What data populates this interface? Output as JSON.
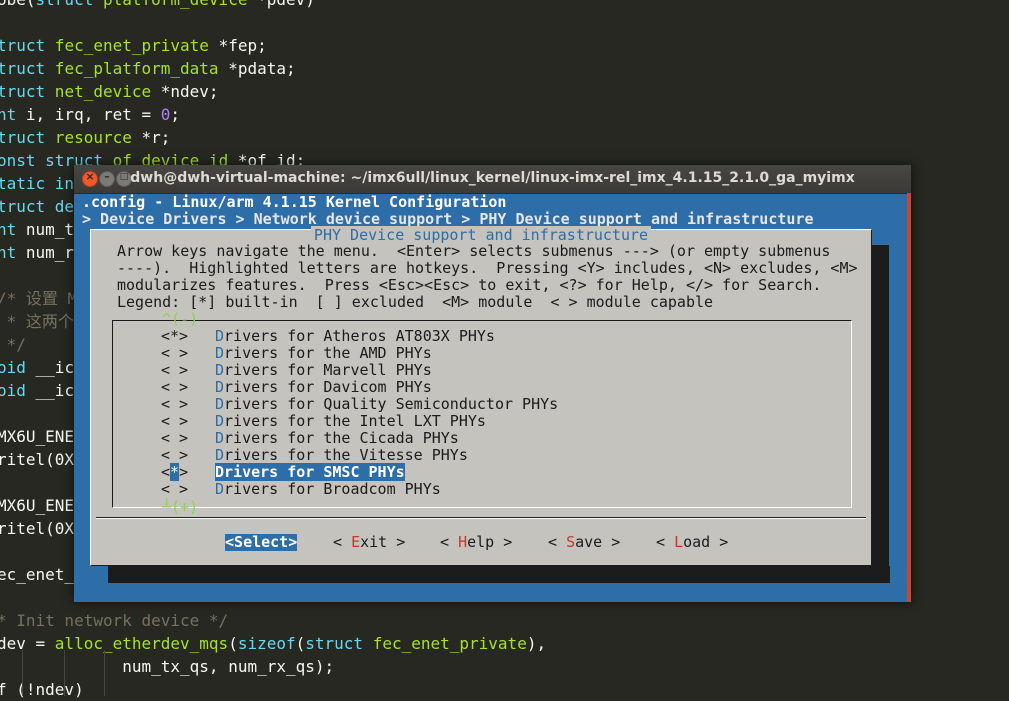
{
  "editor": {
    "lines": [
      {
        "parts": [
          {
            "t": "obe(",
            "c": ""
          },
          {
            "t": "struct",
            "c": "kw"
          },
          {
            "t": " platform_device ",
            "c": "ty"
          },
          {
            "t": "*pdev)",
            "c": ""
          }
        ]
      },
      {
        "parts": []
      },
      {
        "parts": [
          {
            "t": "truct",
            "c": "kw"
          },
          {
            "t": " fec_enet_private ",
            "c": "ty"
          },
          {
            "t": "*fep;",
            "c": ""
          }
        ]
      },
      {
        "parts": [
          {
            "t": "truct",
            "c": "kw"
          },
          {
            "t": " fec_platform_data ",
            "c": "ty"
          },
          {
            "t": "*pdata;",
            "c": ""
          }
        ]
      },
      {
        "parts": [
          {
            "t": "truct",
            "c": "kw"
          },
          {
            "t": " net_device ",
            "c": "ty"
          },
          {
            "t": "*ndev;",
            "c": ""
          }
        ]
      },
      {
        "parts": [
          {
            "t": "nt",
            "c": "kw"
          },
          {
            "t": " i, irq, ret = ",
            "c": ""
          },
          {
            "t": "0",
            "c": "nm"
          },
          {
            "t": ";",
            "c": ""
          }
        ]
      },
      {
        "parts": [
          {
            "t": "truct",
            "c": "kw"
          },
          {
            "t": " resource ",
            "c": "ty"
          },
          {
            "t": "*r;",
            "c": ""
          }
        ]
      },
      {
        "parts": [
          {
            "t": "onst struct",
            "c": "kw"
          },
          {
            "t": " of_device_id ",
            "c": "ty"
          },
          {
            "t": "*of_id;",
            "c": ""
          }
        ]
      },
      {
        "parts": [
          {
            "t": "tatic in",
            "c": "kw"
          }
        ]
      },
      {
        "parts": [
          {
            "t": "truct de",
            "c": "kw"
          }
        ]
      },
      {
        "parts": [
          {
            "t": "nt",
            "c": "kw"
          },
          {
            "t": " num_t",
            "c": ""
          }
        ]
      },
      {
        "parts": [
          {
            "t": "nt",
            "c": "kw"
          },
          {
            "t": " num_r",
            "c": ""
          }
        ]
      },
      {
        "parts": []
      },
      {
        "parts": [
          {
            "t": "/* 设置 M",
            "c": "cm"
          }
        ]
      },
      {
        "parts": [
          {
            "t": " * 这两个",
            "c": "cm"
          }
        ]
      },
      {
        "parts": [
          {
            "t": " */",
            "c": "cm"
          }
        ]
      },
      {
        "parts": [
          {
            "t": "oid",
            "c": "kw"
          },
          {
            "t": " __ic",
            "c": ""
          }
        ]
      },
      {
        "parts": [
          {
            "t": "oid",
            "c": "kw"
          },
          {
            "t": " __ic",
            "c": ""
          }
        ]
      },
      {
        "parts": []
      },
      {
        "parts": [
          {
            "t": "MX6U_ENE",
            "c": ""
          }
        ]
      },
      {
        "parts": [
          {
            "t": "ritel(0X",
            "c": ""
          }
        ]
      },
      {
        "parts": []
      },
      {
        "parts": [
          {
            "t": "MX6U_ENE",
            "c": ""
          }
        ]
      },
      {
        "parts": [
          {
            "t": "ritel(0X",
            "c": ""
          }
        ]
      },
      {
        "parts": []
      },
      {
        "parts": [
          {
            "t": "ec_enet_",
            "c": ""
          }
        ]
      },
      {
        "parts": []
      },
      {
        "parts": [
          {
            "t": "* Init network device */",
            "c": "cm"
          }
        ]
      },
      {
        "parts": [
          {
            "t": "dev = ",
            "c": ""
          },
          {
            "t": "alloc_etherdev_mqs",
            "c": "fn"
          },
          {
            "t": "(",
            "c": ""
          },
          {
            "t": "sizeof",
            "c": "kw"
          },
          {
            "t": "(",
            "c": ""
          },
          {
            "t": "struct",
            "c": "kw"
          },
          {
            "t": " fec_enet_private",
            "c": "ty"
          },
          {
            "t": "),",
            "c": ""
          }
        ]
      },
      {
        "parts": [
          {
            "t": "             num_tx_qs, num_rx_qs);",
            "c": ""
          }
        ]
      },
      {
        "parts": [
          {
            "t": "f (!ndev)",
            "c": ""
          }
        ]
      }
    ]
  },
  "window": {
    "title": "dwh@dwh-virtual-machine: ~/imx6ull/linux_kernel/linux-imx-rel_imx_4.1.15_2.1.0_ga_myimx",
    "close_glyph": "×",
    "min_glyph": "–",
    "max_glyph": "□"
  },
  "menuconfig": {
    "header": ".config - Linux/arm 4.1.15 Kernel Configuration",
    "breadcrumb": "> Device Drivers > Network device support > PHY Device support and infrastructure",
    "dialog_title": "PHY Device support and infrastructure",
    "help_lines": [
      "Arrow keys navigate the menu.  <Enter> selects submenus ---> (or empty submenus",
      "----).  Highlighted letters are hotkeys.  Pressing <Y> includes, <N> excludes, <M>",
      "modularizes features.  Press <Esc><Esc> to exit, <?> for Help, </> for Search.",
      "Legend: [*] built-in  [ ] excluded  <M> module  < > module capable"
    ],
    "scroll_up": "^(-)",
    "scroll_down": "┴(+)",
    "items": [
      {
        "mark": "<*>",
        "hot": "D",
        "rest": "rivers for Atheros AT803X PHYs",
        "selected": false
      },
      {
        "mark": "< >",
        "hot": "D",
        "rest": "rivers for the AMD PHYs",
        "selected": false
      },
      {
        "mark": "< >",
        "hot": "D",
        "rest": "rivers for Marvell PHYs",
        "selected": false
      },
      {
        "mark": "< >",
        "hot": "D",
        "rest": "rivers for Davicom PHYs",
        "selected": false
      },
      {
        "mark": "< >",
        "hot": "D",
        "rest": "rivers for Quality Semiconductor PHYs",
        "selected": false
      },
      {
        "mark": "< >",
        "hot": "D",
        "rest": "rivers for the Intel LXT PHYs",
        "selected": false
      },
      {
        "mark": "< >",
        "hot": "D",
        "rest": "rivers for the Cicada PHYs",
        "selected": false
      },
      {
        "mark": "< >",
        "hot": "D",
        "rest": "rivers for the Vitesse PHYs",
        "selected": false
      },
      {
        "mark": "<*>",
        "hot": "D",
        "rest": "rivers for SMSC PHYs",
        "selected": true
      },
      {
        "mark": "< >",
        "hot": "D",
        "rest": "rivers for Broadcom PHYs",
        "selected": false
      }
    ],
    "buttons": [
      {
        "pre": "<",
        "hot": "S",
        "post": "elect>",
        "active": true
      },
      {
        "pre": "< ",
        "hot": "E",
        "post": "xit >",
        "active": false
      },
      {
        "pre": "< ",
        "hot": "H",
        "post": "elp >",
        "active": false
      },
      {
        "pre": "< ",
        "hot": "S",
        "post": "ave >",
        "active": false
      },
      {
        "pre": "< ",
        "hot": "L",
        "post": "oad >",
        "active": false
      }
    ]
  }
}
